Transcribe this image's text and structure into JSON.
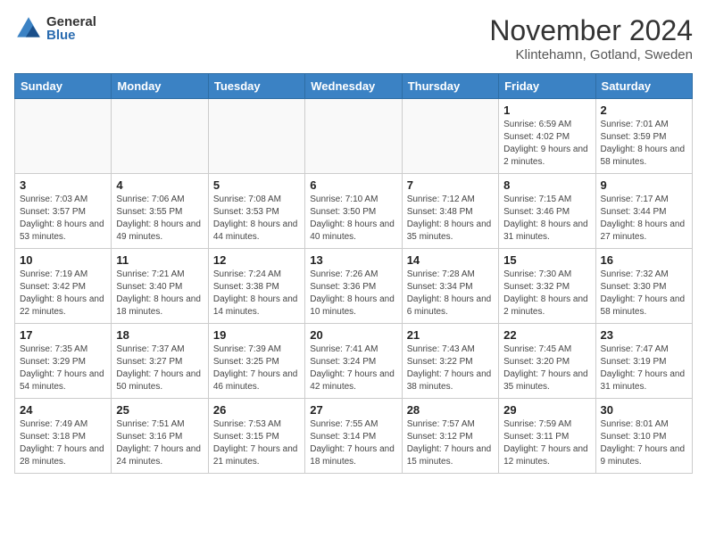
{
  "logo": {
    "general": "General",
    "blue": "Blue"
  },
  "title": {
    "month": "November 2024",
    "location": "Klintehamn, Gotland, Sweden"
  },
  "weekdays": [
    "Sunday",
    "Monday",
    "Tuesday",
    "Wednesday",
    "Thursday",
    "Friday",
    "Saturday"
  ],
  "weeks": [
    [
      {
        "day": "",
        "detail": ""
      },
      {
        "day": "",
        "detail": ""
      },
      {
        "day": "",
        "detail": ""
      },
      {
        "day": "",
        "detail": ""
      },
      {
        "day": "",
        "detail": ""
      },
      {
        "day": "1",
        "detail": "Sunrise: 6:59 AM\nSunset: 4:02 PM\nDaylight: 9 hours\nand 2 minutes."
      },
      {
        "day": "2",
        "detail": "Sunrise: 7:01 AM\nSunset: 3:59 PM\nDaylight: 8 hours\nand 58 minutes."
      }
    ],
    [
      {
        "day": "3",
        "detail": "Sunrise: 7:03 AM\nSunset: 3:57 PM\nDaylight: 8 hours\nand 53 minutes."
      },
      {
        "day": "4",
        "detail": "Sunrise: 7:06 AM\nSunset: 3:55 PM\nDaylight: 8 hours\nand 49 minutes."
      },
      {
        "day": "5",
        "detail": "Sunrise: 7:08 AM\nSunset: 3:53 PM\nDaylight: 8 hours\nand 44 minutes."
      },
      {
        "day": "6",
        "detail": "Sunrise: 7:10 AM\nSunset: 3:50 PM\nDaylight: 8 hours\nand 40 minutes."
      },
      {
        "day": "7",
        "detail": "Sunrise: 7:12 AM\nSunset: 3:48 PM\nDaylight: 8 hours\nand 35 minutes."
      },
      {
        "day": "8",
        "detail": "Sunrise: 7:15 AM\nSunset: 3:46 PM\nDaylight: 8 hours\nand 31 minutes."
      },
      {
        "day": "9",
        "detail": "Sunrise: 7:17 AM\nSunset: 3:44 PM\nDaylight: 8 hours\nand 27 minutes."
      }
    ],
    [
      {
        "day": "10",
        "detail": "Sunrise: 7:19 AM\nSunset: 3:42 PM\nDaylight: 8 hours\nand 22 minutes."
      },
      {
        "day": "11",
        "detail": "Sunrise: 7:21 AM\nSunset: 3:40 PM\nDaylight: 8 hours\nand 18 minutes."
      },
      {
        "day": "12",
        "detail": "Sunrise: 7:24 AM\nSunset: 3:38 PM\nDaylight: 8 hours\nand 14 minutes."
      },
      {
        "day": "13",
        "detail": "Sunrise: 7:26 AM\nSunset: 3:36 PM\nDaylight: 8 hours\nand 10 minutes."
      },
      {
        "day": "14",
        "detail": "Sunrise: 7:28 AM\nSunset: 3:34 PM\nDaylight: 8 hours\nand 6 minutes."
      },
      {
        "day": "15",
        "detail": "Sunrise: 7:30 AM\nSunset: 3:32 PM\nDaylight: 8 hours\nand 2 minutes."
      },
      {
        "day": "16",
        "detail": "Sunrise: 7:32 AM\nSunset: 3:30 PM\nDaylight: 7 hours\nand 58 minutes."
      }
    ],
    [
      {
        "day": "17",
        "detail": "Sunrise: 7:35 AM\nSunset: 3:29 PM\nDaylight: 7 hours\nand 54 minutes."
      },
      {
        "day": "18",
        "detail": "Sunrise: 7:37 AM\nSunset: 3:27 PM\nDaylight: 7 hours\nand 50 minutes."
      },
      {
        "day": "19",
        "detail": "Sunrise: 7:39 AM\nSunset: 3:25 PM\nDaylight: 7 hours\nand 46 minutes."
      },
      {
        "day": "20",
        "detail": "Sunrise: 7:41 AM\nSunset: 3:24 PM\nDaylight: 7 hours\nand 42 minutes."
      },
      {
        "day": "21",
        "detail": "Sunrise: 7:43 AM\nSunset: 3:22 PM\nDaylight: 7 hours\nand 38 minutes."
      },
      {
        "day": "22",
        "detail": "Sunrise: 7:45 AM\nSunset: 3:20 PM\nDaylight: 7 hours\nand 35 minutes."
      },
      {
        "day": "23",
        "detail": "Sunrise: 7:47 AM\nSunset: 3:19 PM\nDaylight: 7 hours\nand 31 minutes."
      }
    ],
    [
      {
        "day": "24",
        "detail": "Sunrise: 7:49 AM\nSunset: 3:18 PM\nDaylight: 7 hours\nand 28 minutes."
      },
      {
        "day": "25",
        "detail": "Sunrise: 7:51 AM\nSunset: 3:16 PM\nDaylight: 7 hours\nand 24 minutes."
      },
      {
        "day": "26",
        "detail": "Sunrise: 7:53 AM\nSunset: 3:15 PM\nDaylight: 7 hours\nand 21 minutes."
      },
      {
        "day": "27",
        "detail": "Sunrise: 7:55 AM\nSunset: 3:14 PM\nDaylight: 7 hours\nand 18 minutes."
      },
      {
        "day": "28",
        "detail": "Sunrise: 7:57 AM\nSunset: 3:12 PM\nDaylight: 7 hours\nand 15 minutes."
      },
      {
        "day": "29",
        "detail": "Sunrise: 7:59 AM\nSunset: 3:11 PM\nDaylight: 7 hours\nand 12 minutes."
      },
      {
        "day": "30",
        "detail": "Sunrise: 8:01 AM\nSunset: 3:10 PM\nDaylight: 7 hours\nand 9 minutes."
      }
    ]
  ]
}
